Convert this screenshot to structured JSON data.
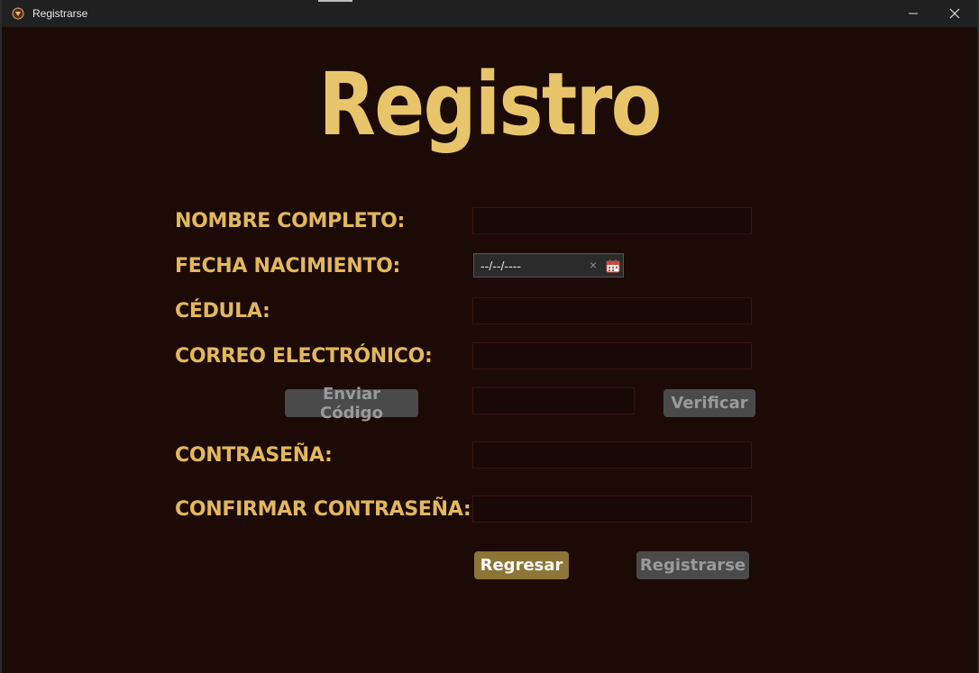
{
  "window": {
    "title": "Registrarse"
  },
  "page": {
    "heading": "Registro"
  },
  "form": {
    "full_name_label": "NOMBRE COMPLETO:",
    "birth_date_label": "FECHA NACIMIENTO:",
    "birth_date_value": "--/--/----",
    "birth_date_clear": "×",
    "id_label": "CÉDULA:",
    "email_label": "CORREO ELECTRÓNICO:",
    "send_code_label": "Enviar Código",
    "verify_label": "Verificar",
    "password_label": "CONTRASEÑA:",
    "confirm_password_label": "CONFIRMAR CONTRASEÑA:"
  },
  "actions": {
    "back_label": "Regresar",
    "register_label": "Registrarse"
  },
  "colors": {
    "background": "#1c0a07",
    "accent_gold": "#e3b85c",
    "primary_button": "#8d7437",
    "disabled_button": "#4a4a4a"
  }
}
